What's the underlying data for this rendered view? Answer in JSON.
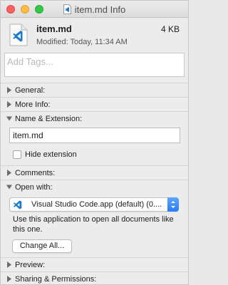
{
  "window": {
    "title": "item.md Info",
    "file_icon": "vscode-file-icon"
  },
  "header": {
    "filename": "item.md",
    "size": "4 KB",
    "modified": "Modified: Today, 11:34 AM"
  },
  "tags": {
    "placeholder": "Add Tags..."
  },
  "sections": {
    "general": "General:",
    "more_info": "More Info:",
    "name_extension": "Name & Extension:",
    "comments": "Comments:",
    "open_with": "Open with:",
    "preview": "Preview:",
    "sharing": "Sharing & Permissions:"
  },
  "name_extension": {
    "value": "item.md",
    "hide_extension_label": "Hide extension",
    "hide_extension_checked": false
  },
  "open_with": {
    "selected_app": "Visual Studio Code.app (default) (0....",
    "app_icon": "vscode-icon",
    "help_text": "Use this application to open all documents like this one.",
    "change_all_label": "Change All..."
  },
  "colors": {
    "vscode_blue": "#1f7acc",
    "select_accent": "#2a7cf5",
    "close": "#fc605c",
    "minimize": "#fdbc40",
    "maximize": "#34c84a"
  }
}
